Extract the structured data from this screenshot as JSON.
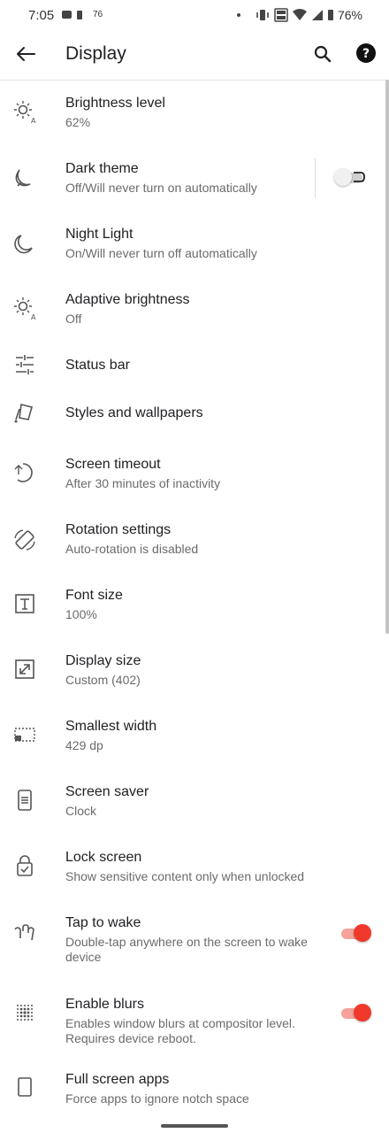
{
  "status_bar": {
    "time": "7:05",
    "left_number": "76",
    "battery": "76%"
  },
  "app_bar": {
    "title": "Display",
    "icons": [
      "back-arrow-icon",
      "search-icon",
      "help-icon"
    ]
  },
  "items": [
    {
      "title": "Brightness level",
      "subtitle": "62%",
      "icon": "brightness-icon"
    },
    {
      "title": "Dark theme",
      "subtitle": "Off/Will never turn on automatically",
      "icon": "dark-theme-icon",
      "toggle": false
    },
    {
      "title": "Night Light",
      "subtitle": "On/Will never turn off automatically",
      "icon": "night-light-icon"
    },
    {
      "title": "Adaptive brightness",
      "subtitle": "Off",
      "icon": "adaptive-brightness-icon"
    },
    {
      "title": "Status bar",
      "subtitle": "",
      "icon": "tune-icon"
    },
    {
      "title": "Styles and wallpapers",
      "subtitle": "",
      "icon": "styles-icon"
    },
    {
      "title": "Screen timeout",
      "subtitle": "After 30 minutes of inactivity",
      "icon": "screen-timeout-icon"
    },
    {
      "title": "Rotation settings",
      "subtitle": "Auto-rotation is disabled",
      "icon": "rotation-icon"
    },
    {
      "title": "Font size",
      "subtitle": "100%",
      "icon": "font-size-icon"
    },
    {
      "title": "Display size",
      "subtitle": "Custom (402)",
      "icon": "display-size-icon"
    },
    {
      "title": "Smallest width",
      "subtitle": "429 dp",
      "icon": "smallest-width-icon"
    },
    {
      "title": "Screen saver",
      "subtitle": "Clock",
      "icon": "screen-saver-icon"
    },
    {
      "title": "Lock screen",
      "subtitle": "Show sensitive content only when unlocked",
      "icon": "lock-screen-icon"
    },
    {
      "title": "Tap to wake",
      "subtitle": "Double-tap anywhere on the screen to wake device",
      "icon": "tap-to-wake-icon",
      "toggle": true
    },
    {
      "title": "Enable blurs",
      "subtitle": "Enables window blurs at compositor level. Requires device reboot.",
      "icon": "blur-icon",
      "toggle": true
    },
    {
      "title": "Full screen apps",
      "subtitle": "Force apps to ignore notch space",
      "icon": "full-screen-icon"
    }
  ],
  "colors": {
    "accent": "#f0392b",
    "accent_track": "#f4a29a",
    "toggle_off_knob": "#f1f1f1",
    "toggle_off_track": "#cfcfcf",
    "text_primary": "#202124",
    "text_secondary": "#6b6b6b"
  }
}
